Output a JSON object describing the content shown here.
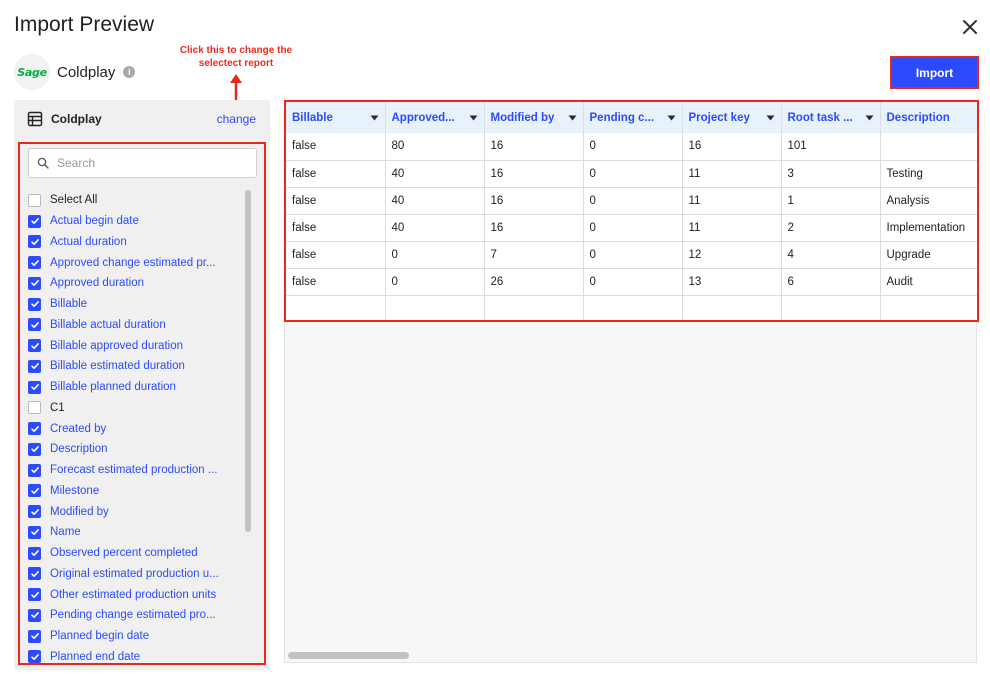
{
  "dialog": {
    "title": "Import Preview"
  },
  "brand": {
    "logo_text": "Sage",
    "name": "Coldplay",
    "info_glyph": "i"
  },
  "annotation": {
    "text": "Click this to change the selectect report"
  },
  "toolbar": {
    "import_label": "Import"
  },
  "report": {
    "name": "Coldplay",
    "change_label": "change"
  },
  "search": {
    "placeholder": "Search",
    "value": ""
  },
  "fields": [
    {
      "label": "Select All",
      "checked": false
    },
    {
      "label": "Actual begin date",
      "checked": true
    },
    {
      "label": "Actual duration",
      "checked": true
    },
    {
      "label": "Approved change estimated pr...",
      "checked": true
    },
    {
      "label": "Approved duration",
      "checked": true
    },
    {
      "label": "Billable",
      "checked": true
    },
    {
      "label": "Billable actual duration",
      "checked": true
    },
    {
      "label": "Billable approved duration",
      "checked": true
    },
    {
      "label": "Billable estimated duration",
      "checked": true
    },
    {
      "label": "Billable planned duration",
      "checked": true
    },
    {
      "label": "C1",
      "checked": false
    },
    {
      "label": "Created by",
      "checked": true
    },
    {
      "label": "Description",
      "checked": true
    },
    {
      "label": "Forecast estimated production ...",
      "checked": true
    },
    {
      "label": "Milestone",
      "checked": true
    },
    {
      "label": "Modified by",
      "checked": true
    },
    {
      "label": "Name",
      "checked": true
    },
    {
      "label": "Observed percent completed",
      "checked": true
    },
    {
      "label": "Original estimated production u...",
      "checked": true
    },
    {
      "label": "Other estimated production units",
      "checked": true
    },
    {
      "label": "Pending change estimated pro...",
      "checked": true
    },
    {
      "label": "Planned begin date",
      "checked": true
    },
    {
      "label": "Planned end date",
      "checked": true
    }
  ],
  "grid": {
    "columns": [
      "Billable",
      "Approved...",
      "Modified by",
      "Pending c...",
      "Project key",
      "Root task ...",
      "Description",
      ""
    ],
    "rows": [
      [
        "false",
        "80",
        "16",
        "0",
        "16",
        "101",
        "",
        ""
      ],
      [
        "false",
        "40",
        "16",
        "0",
        "11",
        "3",
        "Testing",
        ""
      ],
      [
        "false",
        "40",
        "16",
        "0",
        "11",
        "1",
        "Analysis",
        ""
      ],
      [
        "false",
        "40",
        "16",
        "0",
        "11",
        "2",
        "Implementation",
        ""
      ],
      [
        "false",
        "0",
        "7",
        "0",
        "12",
        "4",
        "Upgrade",
        ""
      ],
      [
        "false",
        "0",
        "26",
        "0",
        "13",
        "6",
        "Audit",
        ""
      ],
      [
        "",
        "",
        "",
        "",
        "",
        "",
        "",
        ""
      ]
    ]
  },
  "colors": {
    "accent": "#2c4bff",
    "annotation": "#e8281a",
    "header_bg": "#e8f2fd",
    "logo_green": "#00b140"
  },
  "icons": {
    "close": "close-icon",
    "info": "info-icon",
    "table": "table-icon",
    "search": "search-icon",
    "check": "check-icon",
    "caret": "caret-down-icon",
    "arrow": "arrow-up-icon"
  }
}
